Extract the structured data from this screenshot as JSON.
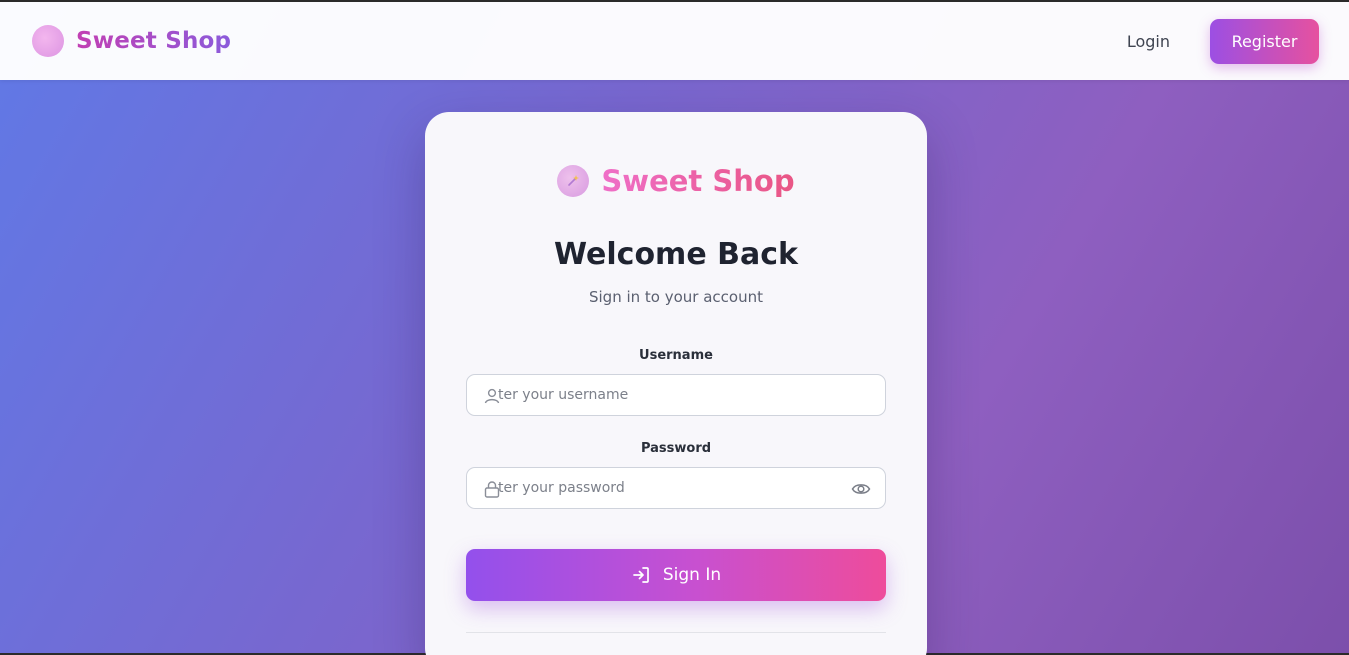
{
  "navbar": {
    "brand_name": "Sweet Shop",
    "login_label": "Login",
    "register_label": "Register"
  },
  "card": {
    "brand_name": "Sweet Shop",
    "title": "Welcome Back",
    "subtitle": "Sign in to your account",
    "username": {
      "label": "Username",
      "placeholder": "ter your username",
      "value": ""
    },
    "password": {
      "label": "Password",
      "placeholder": "ter your password",
      "value": ""
    },
    "signin_label": "Sign In"
  },
  "icons": {
    "brand": "candy-icon",
    "user": "user-icon",
    "lock": "lock-icon",
    "eye": "eye-icon",
    "signin": "log-in-icon"
  },
  "colors": {
    "accent_start": "#9350ec",
    "accent_end": "#ee4c9b",
    "background_start": "#6079e6",
    "background_end": "#7c4fab"
  }
}
